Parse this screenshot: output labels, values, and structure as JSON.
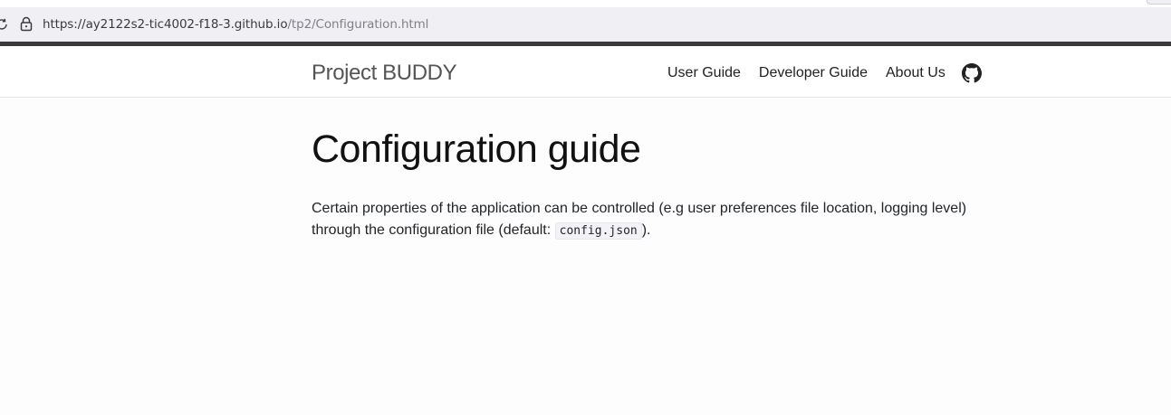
{
  "browser": {
    "url_host": "https://ay2122s2-tic4002-f18-3.github.io",
    "url_path": "/tp2/Configuration.html"
  },
  "navbar": {
    "brand": "Project BUDDY",
    "links": [
      {
        "label": "User Guide"
      },
      {
        "label": "Developer Guide"
      },
      {
        "label": "About Us"
      }
    ],
    "github_icon": "github-icon"
  },
  "main": {
    "title": "Configuration guide",
    "paragraph_before": "Certain properties of the application can be controlled (e.g user preferences file location, logging level) through the configuration file (default: ",
    "code": "config.json",
    "paragraph_after": ")."
  },
  "colors": {
    "address_bar": "#f0f0f4",
    "dark_strip": "#3a3a3a",
    "navbar_bg": "#ffffff",
    "page_bg": "#fdfdfd"
  }
}
